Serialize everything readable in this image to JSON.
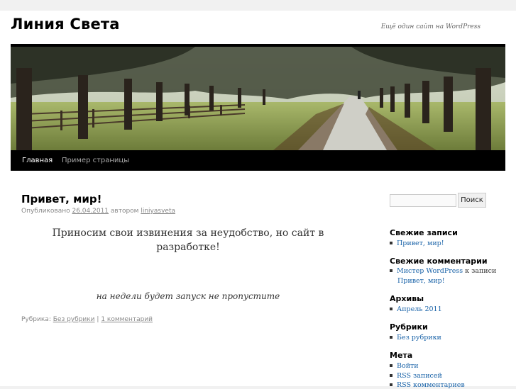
{
  "site": {
    "title": "Линия Света",
    "description": "Ещё один сайт на WordPress"
  },
  "nav": {
    "items": [
      {
        "label": "Главная",
        "current": true
      },
      {
        "label": "Пример страницы",
        "current": false
      }
    ]
  },
  "post": {
    "title": "Привет, мир!",
    "meta_prefix": "Опубликовано",
    "date": "26.04.2011",
    "author_prefix": "автором",
    "author": "liniyasveta",
    "body_line1": "Приносим свои извинения за неудобство, но сайт в разработке!",
    "body_line2": "на недели будет запуск не пропустите",
    "category_prefix": "Рубрика:",
    "category": "Без рубрики",
    "separator": "|",
    "comments": "1 комментарий"
  },
  "sidebar": {
    "search_button": "Поиск",
    "search_value": "",
    "recent_posts": {
      "title": "Свежие записи",
      "items": [
        "Привет, мир!"
      ]
    },
    "recent_comments": {
      "title": "Свежие комментарии",
      "author": "Мистер WordPress",
      "connector": "к записи",
      "post": "Привет, мир!"
    },
    "archives": {
      "title": "Архивы",
      "items": [
        "Апрель 2011"
      ]
    },
    "categories": {
      "title": "Рубрики",
      "items": [
        "Без рубрики"
      ]
    },
    "meta": {
      "title": "Мета",
      "items": [
        "Войти",
        "RSS записей",
        "RSS комментариев"
      ]
    }
  },
  "colors": {
    "background": "#f1f1f1",
    "page": "#ffffff",
    "nav_bar": "#000000",
    "link": "#1a63a8"
  }
}
